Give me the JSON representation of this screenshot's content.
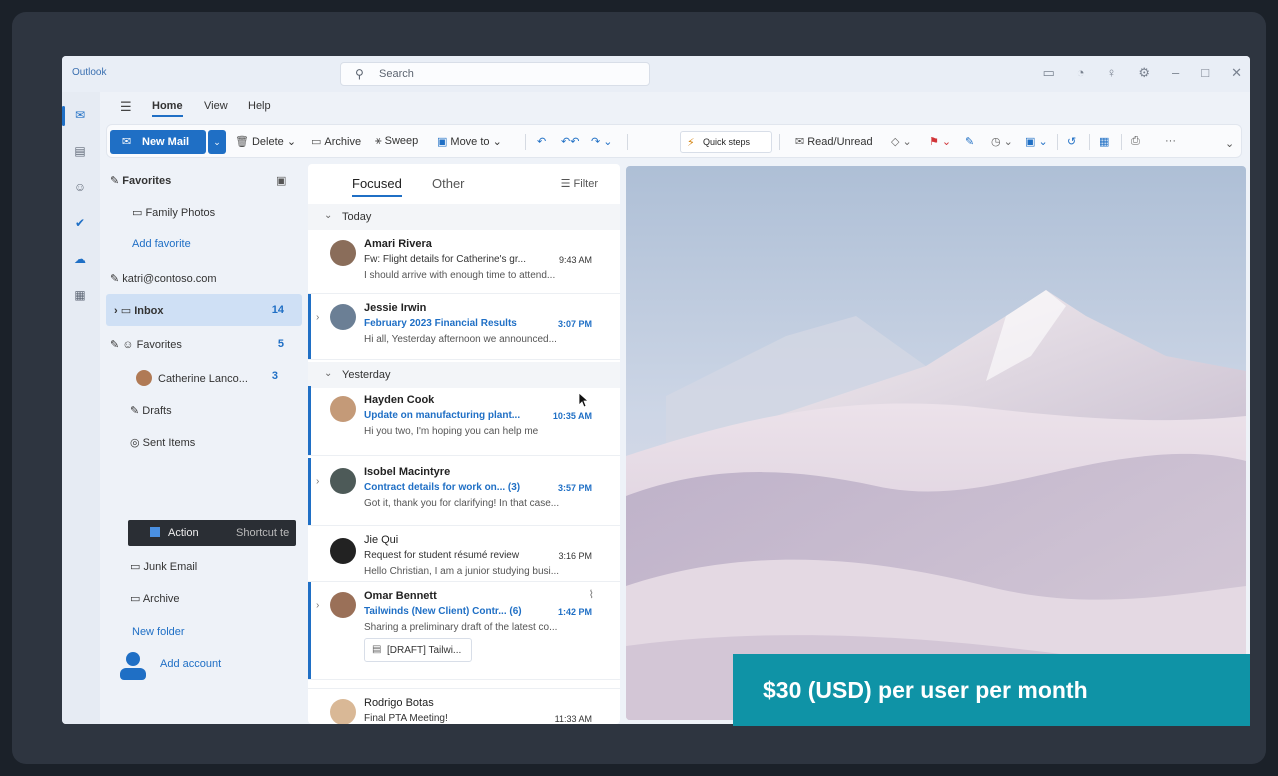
{
  "app": {
    "name": "Outlook"
  },
  "search": {
    "placeholder": "Search"
  },
  "tabs": [
    "Home",
    "View",
    "Help"
  ],
  "ribbon": {
    "new_mail": "New Mail",
    "delete": "Delete",
    "archive": "Archive",
    "sweep": "Sweep",
    "move_to": "Move to",
    "quick_steps": "Quick steps",
    "read_unread": "Read/Unread"
  },
  "folders": {
    "favorites_header": "Favorites",
    "family_photos": "Family Photos",
    "add_favorite": "Add favorite",
    "account": "katri@contoso.com",
    "inbox": "Inbox",
    "inbox_count": "14",
    "favorites_group": "Favorites",
    "favorites_count": "5",
    "catherine": "Catherine Lanco...",
    "catherine_count": "3",
    "drafts": "Drafts",
    "sent_items": "Sent Items",
    "action": "Action",
    "shortcut": "Shortcut te",
    "junk_email": "Junk Email",
    "archive": "Archive",
    "new_folder": "New folder",
    "add_account": "Add account"
  },
  "message_list": {
    "tab_focused": "Focused",
    "tab_other": "Other",
    "filter": "Filter",
    "group_today": "Today",
    "group_yesterday": "Yesterday",
    "messages": [
      {
        "from": "Amari Rivera",
        "subject": "Fw: Flight details for Catherine's gr...",
        "time": "9:43 AM",
        "preview": "I should arrive with enough time to attend..."
      },
      {
        "from": "Jessie Irwin",
        "subject": "February 2023 Financial Results",
        "time": "3:07 PM",
        "preview": "Hi all, Yesterday afternoon we announced..."
      },
      {
        "from": "Hayden Cook",
        "subject": "Update on manufacturing plant...",
        "time": "10:35 AM",
        "preview": "Hi you two, I'm hoping you can help me"
      },
      {
        "from": "Isobel Macintyre",
        "subject": "Contract details for work on... (3)",
        "time": "3:57 PM",
        "preview": "Got it, thank you for clarifying! In that case..."
      },
      {
        "from": "Jie Qui",
        "subject": "Request for student résumé review",
        "time": "3:16 PM",
        "preview": "Hello Christian, I am a junior studying busi..."
      },
      {
        "from": "Omar Bennett",
        "subject": "Tailwinds (New Client) Contr... (6)",
        "time": "1:42 PM",
        "preview": "Sharing a preliminary draft of the latest co...",
        "attachment": "[DRAFT] Tailwi..."
      },
      {
        "from": "Rodrigo Botas",
        "subject": "Final PTA Meeting!",
        "time": "11:33 AM",
        "preview": ""
      }
    ]
  },
  "price_banner": "$30 (USD) per user per month",
  "colors": {
    "accent": "#1f6fc5",
    "banner": "#0f93a6"
  }
}
